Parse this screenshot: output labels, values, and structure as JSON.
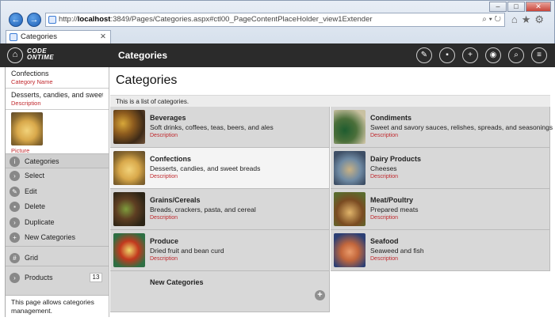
{
  "browser": {
    "url_prefix": "http://",
    "url_host": "localhost",
    "url_rest": ":3849/Pages/Categories.aspx#ctl00_PageContentPlaceHolder_view1Extender",
    "tab_title": "Categories",
    "back_icon": "back-arrow-icon",
    "forward_icon": "forward-arrow-icon"
  },
  "appbar": {
    "logo_line1": "CODE",
    "logo_line2": "ONTIME",
    "title": "Categories"
  },
  "sidebar": {
    "fields": [
      {
        "value": "Confections",
        "label": "Category Name"
      },
      {
        "value": "Desserts, candies, and sweet...",
        "label": "Description"
      }
    ],
    "picture_label": "Picture",
    "group_label": "Categories",
    "actions": [
      {
        "label": "Select",
        "icon": "chevron-right-icon"
      },
      {
        "label": "Edit",
        "icon": "pencil-icon"
      },
      {
        "label": "Delete",
        "icon": "trash-icon"
      },
      {
        "label": "Duplicate",
        "icon": "chevron-right-icon"
      },
      {
        "label": "New Categories",
        "icon": "plus-icon"
      }
    ],
    "grid_label": "Grid",
    "products_label": "Products",
    "products_count": "13",
    "description": "This page allows categories management."
  },
  "main": {
    "title": "Categories",
    "subtitle": "This is a list of categories.",
    "description_label": "Description",
    "categories": [
      {
        "name": "Beverages",
        "description": "Soft drinks, coffees, teas, beers, and ales"
      },
      {
        "name": "Condiments",
        "description": "Sweet and savory sauces, relishes, spreads, and seasonings"
      },
      {
        "name": "Confections",
        "description": "Desserts, candies, and sweet breads"
      },
      {
        "name": "Dairy Products",
        "description": "Cheeses"
      },
      {
        "name": "Grains/Cereals",
        "description": "Breads, crackers, pasta, and cereal"
      },
      {
        "name": "Meat/Poultry",
        "description": "Prepared meats"
      },
      {
        "name": "Produce",
        "description": "Dried fruit and bean curd"
      },
      {
        "name": "Seafood",
        "description": "Seaweed and fish"
      }
    ],
    "new_label": "New Categories"
  }
}
